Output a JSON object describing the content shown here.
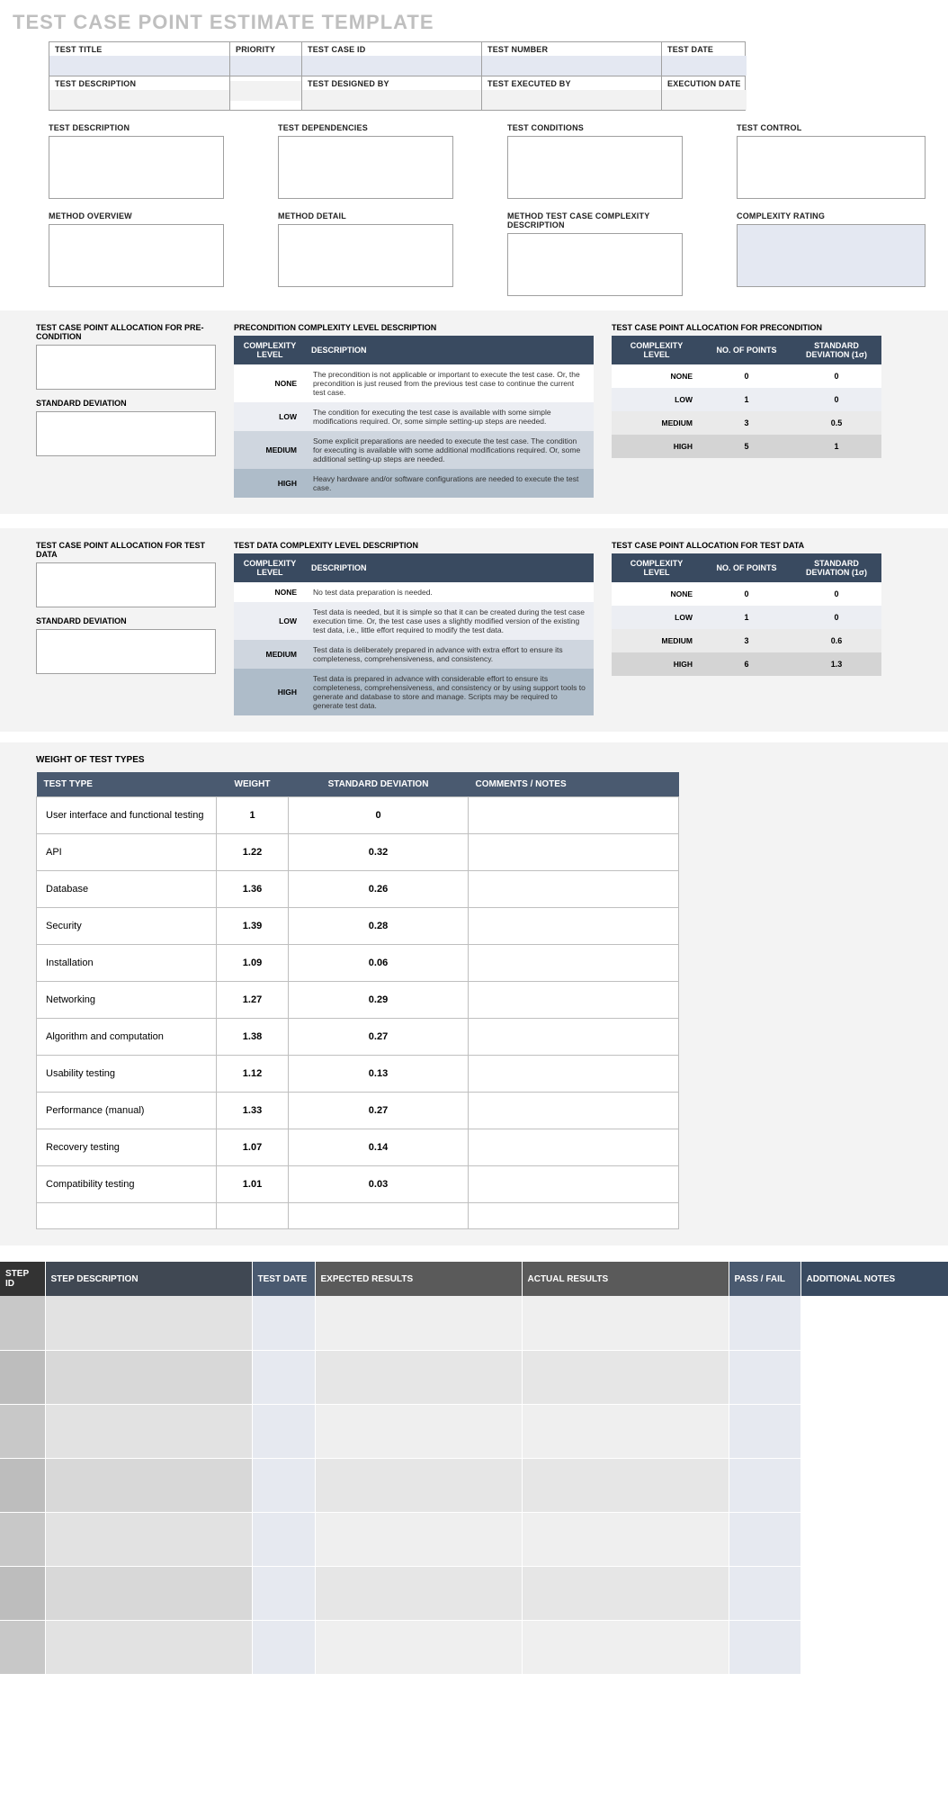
{
  "title": "TEST CASE POINT ESTIMATE TEMPLATE",
  "header_row1": [
    "TEST TITLE",
    "PRIORITY",
    "TEST CASE ID",
    "TEST NUMBER",
    "TEST DATE"
  ],
  "header_row2": [
    "TEST DESCRIPTION",
    "",
    "TEST DESIGNED BY",
    "TEST EXECUTED BY",
    "EXECUTION DATE"
  ],
  "ta_row1": [
    "TEST DESCRIPTION",
    "TEST DEPENDENCIES",
    "TEST CONDITIONS",
    "TEST CONTROL"
  ],
  "ta_row2": [
    "METHOD OVERVIEW",
    "METHOD DETAIL",
    "METHOD TEST CASE COMPLEXITY DESCRIPTION",
    "COMPLEXITY RATING"
  ],
  "precond": {
    "left_top": "TEST CASE POINT ALLOCATION FOR PRE-CONDITION",
    "left_bottom": "STANDARD DEVIATION",
    "desc_title": "PRECONDITION COMPLEXITY LEVEL DESCRIPTION",
    "desc_cols": [
      "COMPLEXITY LEVEL",
      "DESCRIPTION"
    ],
    "rows": [
      {
        "level": "NONE",
        "desc": "The precondition is not applicable or important to execute the test case. Or, the precondition is just reused from the previous test case to continue the current test case."
      },
      {
        "level": "LOW",
        "desc": "The condition for executing the test case is available with some simple modifications required. Or, some simple setting-up steps are needed."
      },
      {
        "level": "MEDIUM",
        "desc": "Some explicit preparations are needed to execute the test case. The condition for executing is available with some additional modifications required. Or, some additional setting-up steps are needed."
      },
      {
        "level": "HIGH",
        "desc": "Heavy hardware and/or software configurations are needed to execute the test case."
      }
    ],
    "alloc_title": "TEST CASE POINT ALLOCATION FOR PRECONDITION",
    "alloc_cols": [
      "COMPLEXITY LEVEL",
      "NO. OF POINTS",
      "STANDARD DEVIATION (1σ)"
    ],
    "alloc_rows": [
      {
        "level": "NONE",
        "pts": "0",
        "sd": "0"
      },
      {
        "level": "LOW",
        "pts": "1",
        "sd": "0"
      },
      {
        "level": "MEDIUM",
        "pts": "3",
        "sd": "0.5"
      },
      {
        "level": "HIGH",
        "pts": "5",
        "sd": "1"
      }
    ]
  },
  "testdata": {
    "left_top": "TEST CASE POINT ALLOCATION FOR TEST DATA",
    "left_bottom": "STANDARD DEVIATION",
    "desc_title": "TEST DATA COMPLEXITY LEVEL DESCRIPTION",
    "desc_cols": [
      "COMPLEXITY LEVEL",
      "DESCRIPTION"
    ],
    "rows": [
      {
        "level": "NONE",
        "desc": "No test data preparation is needed."
      },
      {
        "level": "LOW",
        "desc": "Test data is needed, but it is simple so that it can be created during the test case execution time. Or, the test case uses a slightly modified version of the existing test data, i.e., little effort required to modify the test data."
      },
      {
        "level": "MEDIUM",
        "desc": "Test data is deliberately prepared in advance with extra effort to ensure its completeness, comprehensiveness, and consistency."
      },
      {
        "level": "HIGH",
        "desc": "Test data is prepared in advance with considerable effort to ensure its completeness, comprehensiveness, and consistency or by using support tools to generate and database to store and manage. Scripts may be required to generate test data."
      }
    ],
    "alloc_title": "TEST CASE POINT ALLOCATION FOR TEST DATA",
    "alloc_cols": [
      "COMPLEXITY LEVEL",
      "NO. OF POINTS",
      "STANDARD DEVIATION (1σ)"
    ],
    "alloc_rows": [
      {
        "level": "NONE",
        "pts": "0",
        "sd": "0"
      },
      {
        "level": "LOW",
        "pts": "1",
        "sd": "0"
      },
      {
        "level": "MEDIUM",
        "pts": "3",
        "sd": "0.6"
      },
      {
        "level": "HIGH",
        "pts": "6",
        "sd": "1.3"
      }
    ]
  },
  "weights": {
    "title": "WEIGHT OF TEST TYPES",
    "cols": [
      "TEST TYPE",
      "WEIGHT",
      "STANDARD DEVIATION",
      "COMMENTS / NOTES"
    ],
    "rows": [
      {
        "t": "User interface and functional testing",
        "w": "1",
        "sd": "0"
      },
      {
        "t": "API",
        "w": "1.22",
        "sd": "0.32"
      },
      {
        "t": "Database",
        "w": "1.36",
        "sd": "0.26"
      },
      {
        "t": "Security",
        "w": "1.39",
        "sd": "0.28"
      },
      {
        "t": "Installation",
        "w": "1.09",
        "sd": "0.06"
      },
      {
        "t": "Networking",
        "w": "1.27",
        "sd": "0.29"
      },
      {
        "t": "Algorithm and computation",
        "w": "1.38",
        "sd": "0.27"
      },
      {
        "t": "Usability testing",
        "w": "1.12",
        "sd": "0.13"
      },
      {
        "t": "Performance (manual)",
        "w": "1.33",
        "sd": "0.27"
      },
      {
        "t": "Recovery testing",
        "w": "1.07",
        "sd": "0.14"
      },
      {
        "t": "Compatibility testing",
        "w": "1.01",
        "sd": "0.03"
      },
      {
        "t": "",
        "w": "",
        "sd": ""
      }
    ]
  },
  "steps": {
    "cols": [
      "STEP ID",
      "STEP DESCRIPTION",
      "TEST DATE",
      "EXPECTED RESULTS",
      "ACTUAL RESULTS",
      "PASS / FAIL",
      "ADDITIONAL NOTES"
    ],
    "row_count": 7
  }
}
